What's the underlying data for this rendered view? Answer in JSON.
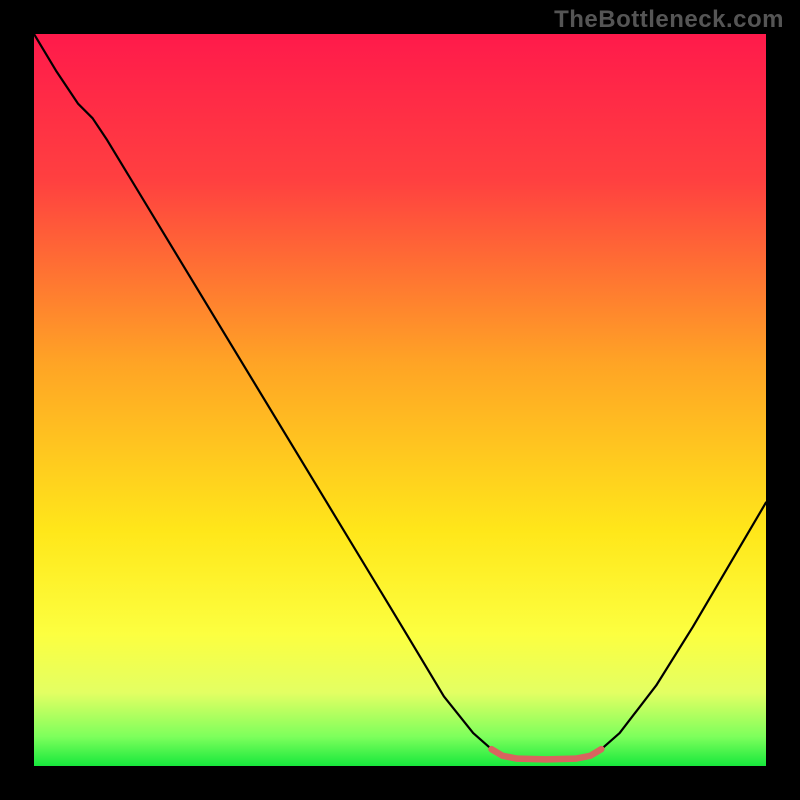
{
  "watermark": "TheBottleneck.com",
  "chart_data": {
    "type": "line",
    "title": "",
    "xlabel": "",
    "ylabel": "",
    "xlim": [
      0,
      100
    ],
    "ylim": [
      0,
      100
    ],
    "background_gradient": {
      "stops": [
        {
          "offset": 0.0,
          "color": "#ff1a4b"
        },
        {
          "offset": 0.2,
          "color": "#ff4040"
        },
        {
          "offset": 0.45,
          "color": "#ffa425"
        },
        {
          "offset": 0.68,
          "color": "#ffe71a"
        },
        {
          "offset": 0.82,
          "color": "#fcff40"
        },
        {
          "offset": 0.9,
          "color": "#e3ff63"
        },
        {
          "offset": 0.96,
          "color": "#7dff5c"
        },
        {
          "offset": 1.0,
          "color": "#17e83c"
        }
      ]
    },
    "series": [
      {
        "name": "bottleneck-curve",
        "color": "#000000",
        "width": 2.2,
        "points": [
          {
            "x": 0.0,
            "y": 100.0
          },
          {
            "x": 3.0,
            "y": 95.0
          },
          {
            "x": 6.0,
            "y": 90.5
          },
          {
            "x": 8.0,
            "y": 88.5
          },
          {
            "x": 10.0,
            "y": 85.5
          },
          {
            "x": 20.0,
            "y": 69.0
          },
          {
            "x": 30.0,
            "y": 52.5
          },
          {
            "x": 40.0,
            "y": 36.0
          },
          {
            "x": 50.0,
            "y": 19.5
          },
          {
            "x": 56.0,
            "y": 9.5
          },
          {
            "x": 60.0,
            "y": 4.5
          },
          {
            "x": 62.5,
            "y": 2.3
          },
          {
            "x": 64.0,
            "y": 1.4
          },
          {
            "x": 66.0,
            "y": 1.0
          },
          {
            "x": 70.0,
            "y": 0.9
          },
          {
            "x": 74.0,
            "y": 1.0
          },
          {
            "x": 76.0,
            "y": 1.4
          },
          {
            "x": 77.5,
            "y": 2.3
          },
          {
            "x": 80.0,
            "y": 4.5
          },
          {
            "x": 85.0,
            "y": 11.0
          },
          {
            "x": 90.0,
            "y": 19.0
          },
          {
            "x": 95.0,
            "y": 27.5
          },
          {
            "x": 100.0,
            "y": 36.0
          }
        ]
      },
      {
        "name": "optimal-zone-marker",
        "color": "#d9645f",
        "width": 6.5,
        "linecap": "round",
        "points": [
          {
            "x": 62.5,
            "y": 2.3
          },
          {
            "x": 64.0,
            "y": 1.4
          },
          {
            "x": 66.0,
            "y": 1.0
          },
          {
            "x": 70.0,
            "y": 0.9
          },
          {
            "x": 74.0,
            "y": 1.0
          },
          {
            "x": 76.0,
            "y": 1.4
          },
          {
            "x": 77.5,
            "y": 2.3
          }
        ]
      }
    ]
  }
}
